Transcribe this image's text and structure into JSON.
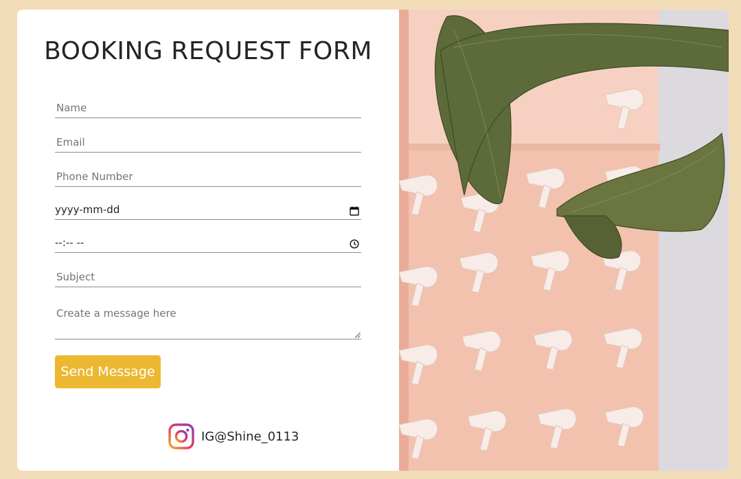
{
  "form": {
    "title": "BOOKING REQUEST FORM",
    "name_placeholder": "Name",
    "email_placeholder": "Email",
    "phone_placeholder": "Phone Number",
    "date_placeholder": "yyyy-mm-dd",
    "time_placeholder": "--:-- --",
    "subject_placeholder": "Subject",
    "message_placeholder": "Create a message here",
    "send_label": "Send Message",
    "instagram_handle": "IG@Shine_0113"
  },
  "icons": {
    "date": "calendar-icon",
    "time": "clock-icon",
    "social": "instagram-icon"
  },
  "colors": {
    "page_background": "#f2dcb8",
    "button": "#ecb831",
    "photo_wall": "#f0b9a6",
    "leaf": "#5d6a3a"
  },
  "photo": {
    "subject": "pink wall with rows of white hair dryers and banana leaves"
  }
}
